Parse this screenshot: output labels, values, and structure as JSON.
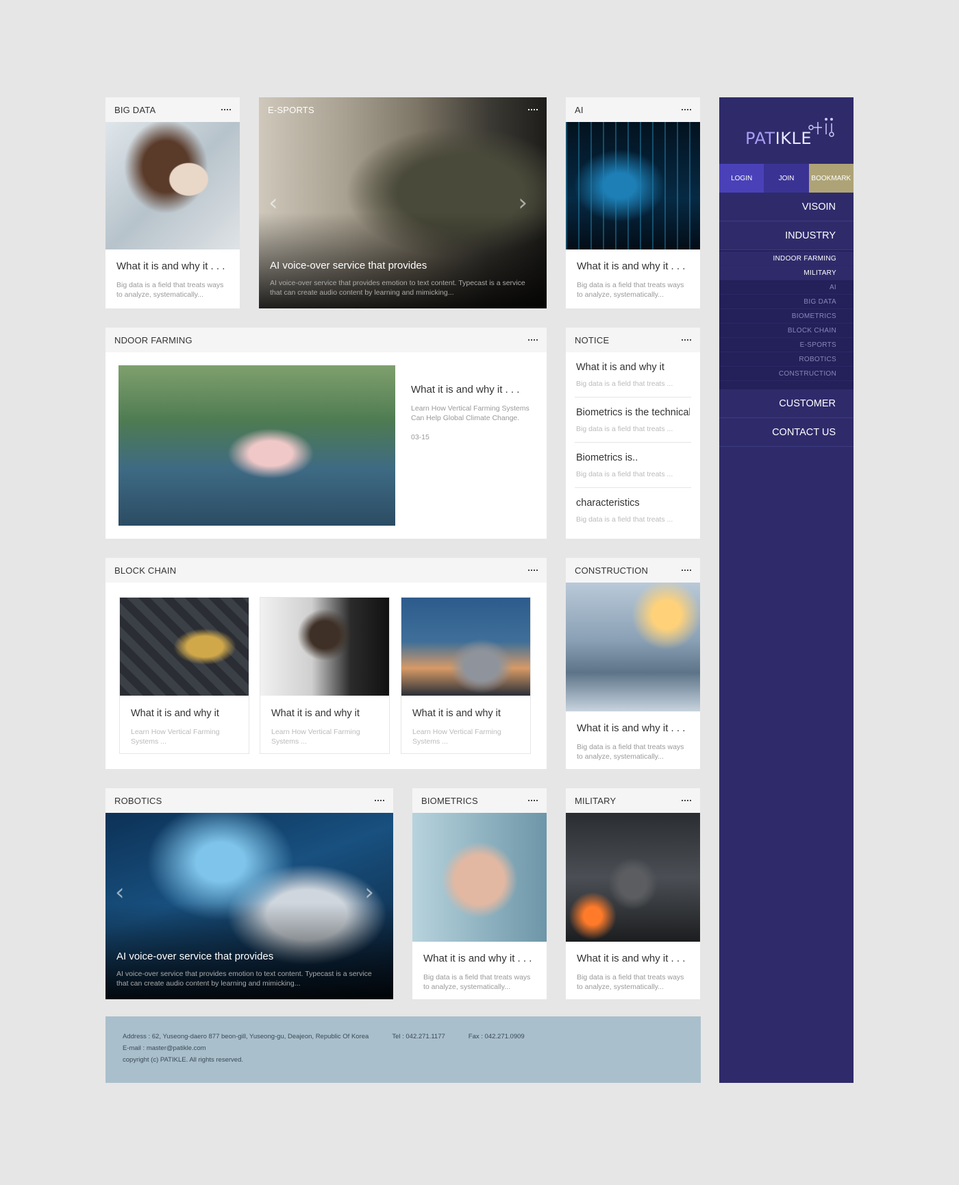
{
  "cards": {
    "bigdata": {
      "label": "BIG DATA",
      "title": "What it is and why it . . .",
      "desc": "Big data is a field that treats ways to analyze, systematically..."
    },
    "esports": {
      "label": "E-SPORTS",
      "title": "AI voice-over service that provides",
      "desc": "AI voice-over service that provides emotion to text content. Typecast is a service that can create audio content by learning and mimicking..."
    },
    "ai": {
      "label": "AI",
      "title": "What it is and why it . . .",
      "desc": "Big data is a field that treats ways to analyze, systematically..."
    },
    "farming": {
      "label": "NDOOR FARMING",
      "title": "What it is and why it . . .",
      "desc": "Learn How Vertical Farming Systems Can Help Global Climate Change.",
      "date": "03-15"
    },
    "notice": {
      "label": "NOTICE",
      "items": [
        {
          "title": "What it is and why it",
          "desc": "Big data is a field that treats ..."
        },
        {
          "title": "Biometrics is the technical",
          "desc": "Big data is a field that treats ..."
        },
        {
          "title": "Biometrics is..",
          "desc": "Big data is a field that treats ..."
        },
        {
          "title": "characteristics",
          "desc": "Big data is a field that treats ..."
        }
      ]
    },
    "blockchain": {
      "label": "BLOCK CHAIN",
      "items": [
        {
          "title": "What it is and why it",
          "desc": "Learn How Vertical Farming Systems ..."
        },
        {
          "title": "What it is and why it",
          "desc": "Learn How Vertical Farming Systems ..."
        },
        {
          "title": "What it is and why it",
          "desc": "Learn How Vertical Farming Systems ..."
        }
      ]
    },
    "construction": {
      "label": "CONSTRUCTION",
      "title": "What it is and why it . . .",
      "desc": "Big data is a field that treats ways to analyze, systematically..."
    },
    "robotics": {
      "label": "ROBOTICS",
      "title": "AI voice-over service that provides",
      "desc": "AI voice-over service that provides emotion to text content. Typecast is a service that can create audio content by learning and mimicking..."
    },
    "biometrics": {
      "label": "BIOMETRICS",
      "title": "What it is and why it . . .",
      "desc": "Big data is a field that treats ways to analyze, systematically..."
    },
    "military": {
      "label": "MILITARY",
      "title": "What it is and why it . . .",
      "desc": "Big data is a field that treats ways to analyze, systematically..."
    }
  },
  "sidebar": {
    "logo_prefix": "PAT",
    "logo_rest": "IKLE",
    "login": "LOGIN",
    "join": "JOIN",
    "bookmark": "BOOKMARK",
    "vision": "VISOIN",
    "industry": "INDUSTRY",
    "sub_items": [
      "INDOOR FARMING",
      "MILITARY",
      "AI",
      "BIG DATA",
      "BIOMETRICS",
      "BLOCK CHAIN",
      "E-SPORTS",
      "ROBOTICS",
      "CONSTRUCTION"
    ],
    "customer": "CUSTOMER",
    "contact": "CONTACT US"
  },
  "footer": {
    "address": "Address : 62, Yuseong-daero 877 beon-gill, Yuseong-gu, Deajeon, Republic Of Korea",
    "tel": "Tel : 042.271.1177",
    "fax": "Fax : 042.271.0909",
    "email": "E-mail : master@patikle.com",
    "copyright": "copyright (c) PATIKLE. All rights reserved."
  },
  "icons": {
    "more": "more-icon",
    "prev": "chevron-left-icon",
    "next": "chevron-right-icon"
  },
  "colors": {
    "sidebar": "#2f2b6b",
    "login": "#4a41b9",
    "join": "#3b3394",
    "bookmark": "#aea377",
    "footer": "#a9bfcc",
    "background": "#e6e6e6"
  }
}
